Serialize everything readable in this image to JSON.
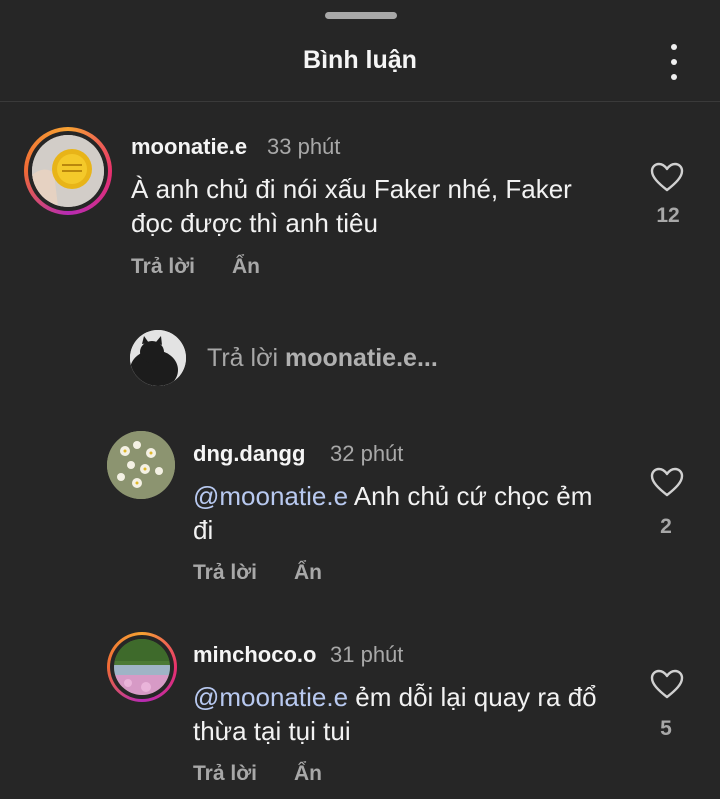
{
  "header": {
    "title": "Bình luận"
  },
  "comments": [
    {
      "username": "moonatie.e",
      "time": "33 phút",
      "text": "À anh chủ đi nói xấu Faker nhé, Faker đọc được thì anh tiêu",
      "mention": "",
      "reply_label": "Trả lời",
      "hide_label": "Ẩn",
      "likes": "12"
    },
    {
      "username": "dng.dangg",
      "time": "32 phút",
      "mention": "@moonatie.e",
      "text": " Anh chủ cứ chọc ẻm đi",
      "reply_label": "Trả lời",
      "hide_label": "Ẩn",
      "likes": "2"
    },
    {
      "username": "minchoco.o",
      "time": "31 phút",
      "mention": "@moonatie.e",
      "text": " ẻm dỗi lại quay ra đổ thừa tại tụi tui",
      "reply_label": "Trả lời",
      "hide_label": "Ẩn",
      "likes": "5"
    }
  ],
  "reply_box": {
    "prefix": "Trả lời ",
    "target": "moonatie.e..."
  }
}
